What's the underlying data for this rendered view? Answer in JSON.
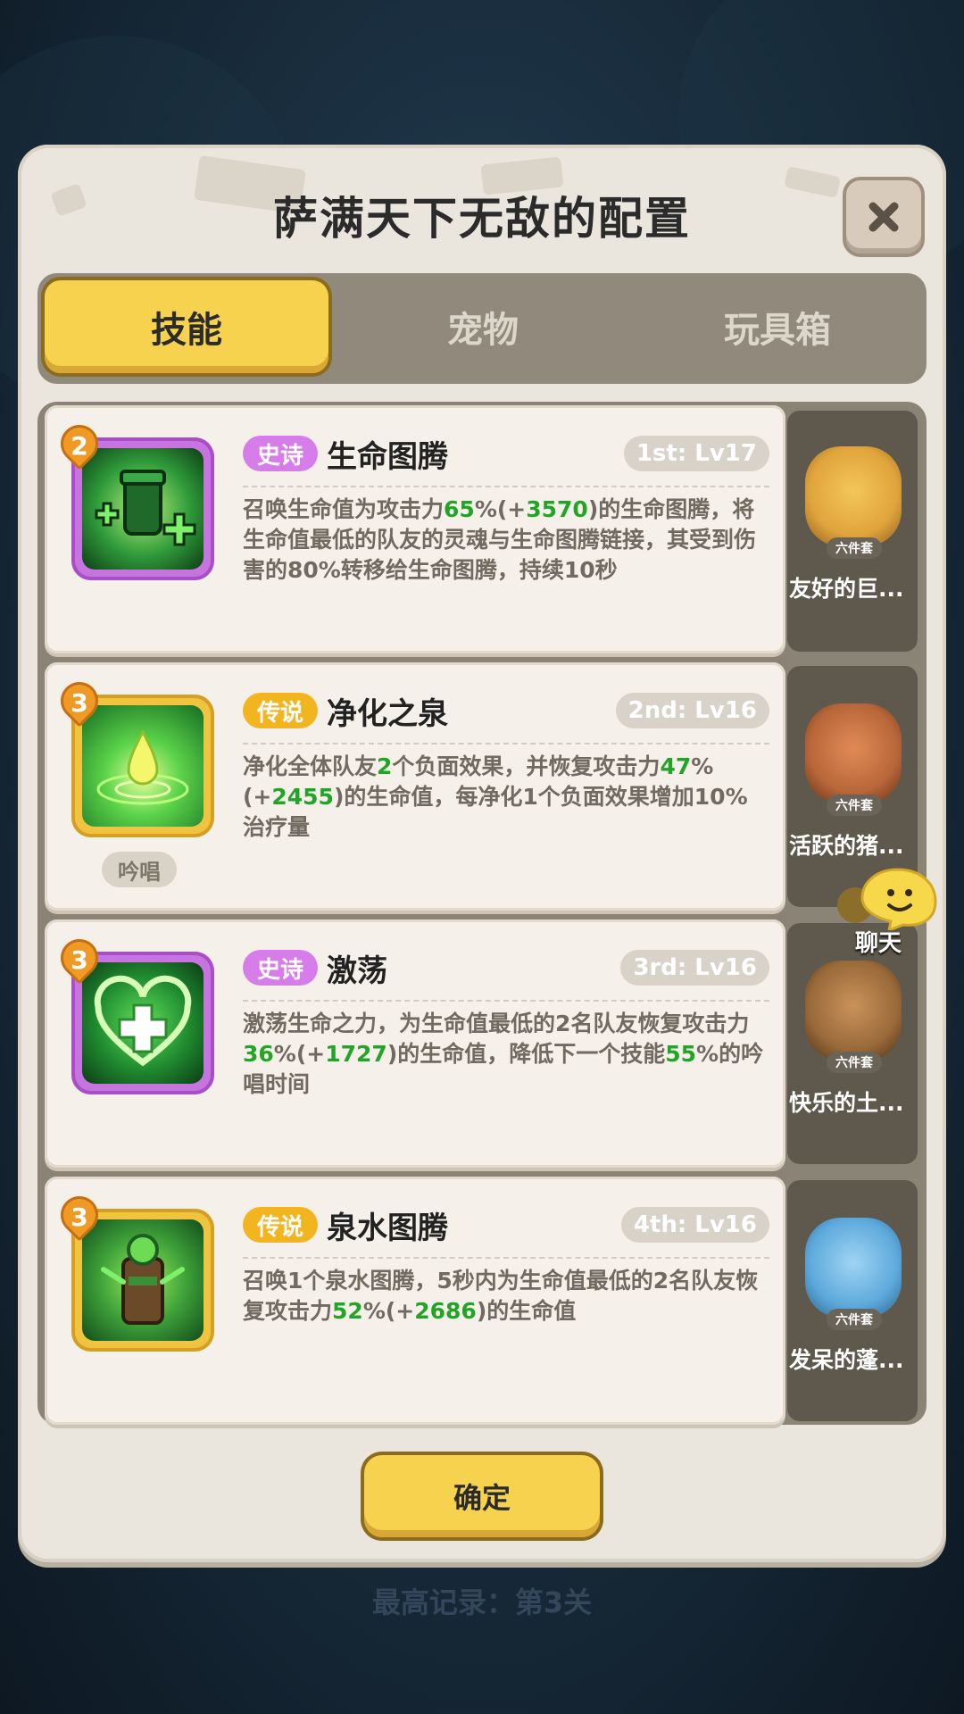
{
  "background": {
    "record_text": "最高记录：第3关"
  },
  "dialog": {
    "title": "萨满天下无敌的配置",
    "close_icon": "close-icon",
    "confirm_label": "确定"
  },
  "tabs": [
    {
      "label": "技能",
      "active": true
    },
    {
      "label": "宠物",
      "active": false
    },
    {
      "label": "玩具箱",
      "active": false
    }
  ],
  "skills": [
    {
      "level": "2",
      "rarity": "史诗",
      "name": "生命图腾",
      "rank": "1st: Lv17",
      "icon": "life-totem-icon",
      "chant": "",
      "desc": [
        {
          "t": "召唤生命值为攻击力",
          "g": false
        },
        {
          "t": "65",
          "g": true
        },
        {
          "t": "%(+",
          "g": false
        },
        {
          "t": "3570",
          "g": true
        },
        {
          "t": ")的生命图腾，将生命值最低的队友的灵魂与生命图腾链接，其受到伤害的80%转移给生命图腾，持续10秒",
          "g": false
        }
      ]
    },
    {
      "level": "3",
      "rarity": "传说",
      "name": "净化之泉",
      "rank": "2nd: Lv16",
      "icon": "purify-spring-icon",
      "chant": "吟唱",
      "desc": [
        {
          "t": "净化全体队友",
          "g": false
        },
        {
          "t": "2",
          "g": true
        },
        {
          "t": "个负面效果，并恢复攻击力",
          "g": false
        },
        {
          "t": "47",
          "g": true
        },
        {
          "t": "%(+",
          "g": false
        },
        {
          "t": "2455",
          "g": true
        },
        {
          "t": ")的生命值，每净化1个负面效果增加10%治疗量",
          "g": false
        }
      ]
    },
    {
      "level": "3",
      "rarity": "史诗",
      "name": "激荡",
      "rank": "3rd: Lv16",
      "icon": "heart-heal-icon",
      "chant": "",
      "desc": [
        {
          "t": "激荡生命之力，为生命值最低的2名队友恢复攻击力",
          "g": false
        },
        {
          "t": "36",
          "g": true
        },
        {
          "t": "%(+",
          "g": false
        },
        {
          "t": "1727",
          "g": true
        },
        {
          "t": ")的生命值，降低下一个技能",
          "g": false
        },
        {
          "t": "55",
          "g": true
        },
        {
          "t": "%的吟唱时间",
          "g": false
        }
      ]
    },
    {
      "level": "3",
      "rarity": "传说",
      "name": "泉水图腾",
      "rank": "4th: Lv16",
      "icon": "spring-totem-icon",
      "chant": "",
      "desc": [
        {
          "t": "召唤1个泉水图腾，5秒内为生命值最低的2名队友恢复攻击力",
          "g": false
        },
        {
          "t": "52",
          "g": true
        },
        {
          "t": "%(+",
          "g": false
        },
        {
          "t": "2686",
          "g": true
        },
        {
          "t": ")的生命值",
          "g": false
        }
      ]
    }
  ],
  "pets": [
    {
      "name": "友好的巨...",
      "tag": "六件套",
      "icon": "win-robot-pet-icon",
      "color": "#e0a43c"
    },
    {
      "name": "活跃的猪...",
      "tag": "六件套",
      "icon": "boar-pet-icon",
      "color": "#b8673a"
    },
    {
      "name": "快乐的土...",
      "tag": "六件套",
      "icon": "groundhog-pet-icon",
      "color": "#9a6a3a"
    },
    {
      "name": "发呆的蓬...",
      "tag": "六件套",
      "icon": "sheep-pet-icon",
      "color": "#5da9dc"
    }
  ],
  "chat": {
    "label": "聊天",
    "icon": "chat-bubble-icon"
  },
  "colors": {
    "accent_yellow": "#f6d24e",
    "epic": "#d77de9",
    "legend": "#f2b51f",
    "value_green": "#22a526"
  }
}
